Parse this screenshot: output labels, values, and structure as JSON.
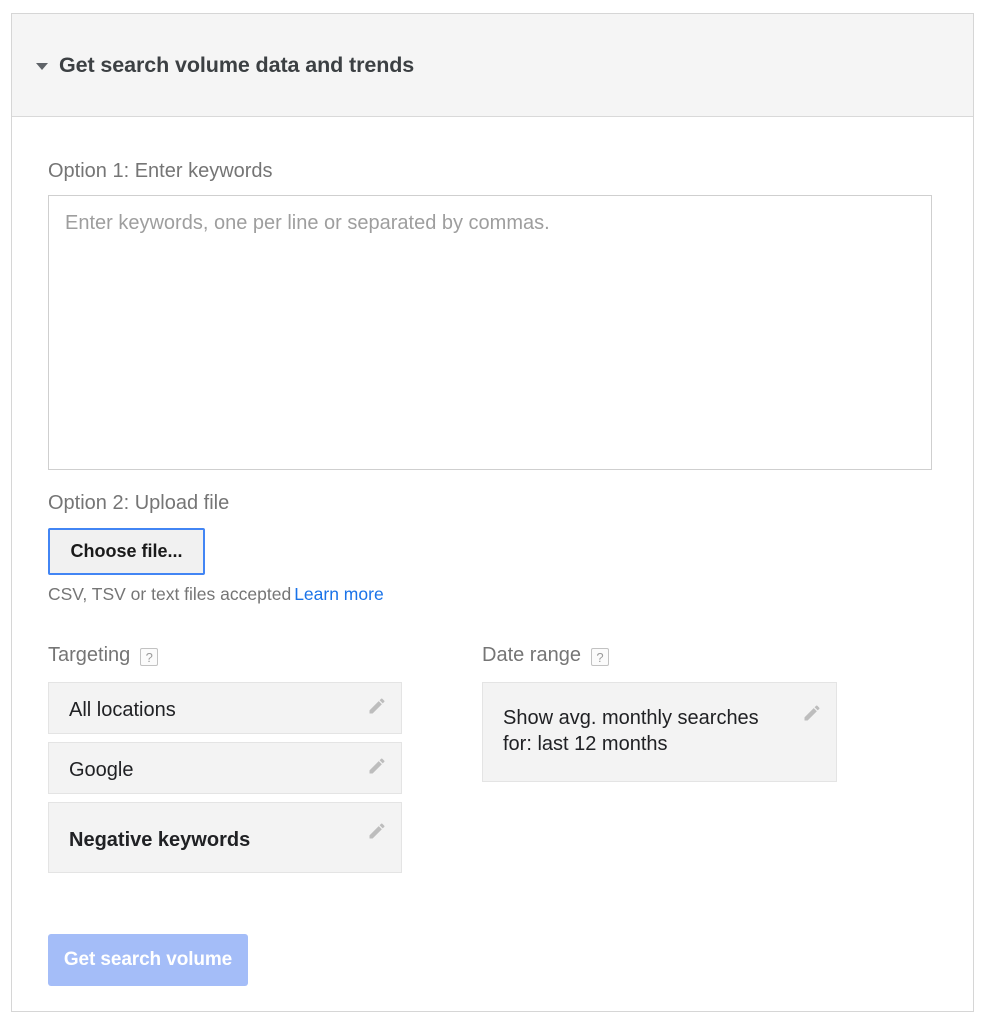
{
  "card": {
    "header": {
      "title": "Get search volume data and trends",
      "caret_icon": "chevron-down-icon"
    }
  },
  "form": {
    "option1": {
      "label": "Option 1: Enter keywords",
      "textarea_placeholder": "Enter keywords, one per line or separated by commas.",
      "textarea_value": ""
    },
    "option2": {
      "label": "Option 2: Upload file",
      "choose_file_label": "Choose file...",
      "hint_text": "CSV, TSV or text files accepted",
      "learn_more_label": "Learn more"
    },
    "targeting": {
      "heading": "Targeting",
      "help_icon_label": "?",
      "items": [
        {
          "label": "All locations",
          "bold": false,
          "edit_icon": "pencil-icon"
        },
        {
          "label": "Google",
          "bold": false,
          "edit_icon": "pencil-icon"
        },
        {
          "label": "Negative keywords",
          "bold": true,
          "edit_icon": "pencil-icon"
        }
      ]
    },
    "date_range": {
      "heading": "Date range",
      "help_icon_label": "?",
      "value_line1": "Show avg. monthly searches",
      "value_line2": "for: last 12 months",
      "edit_icon": "pencil-icon"
    },
    "submit": {
      "label": "Get search volume"
    }
  },
  "colors": {
    "link": "#1a73e8",
    "focus_ring": "#4285f4",
    "submit_fill": "#a4bdf8",
    "header_bg": "#f5f5f5",
    "setting_box_bg": "#f3f3f3"
  }
}
